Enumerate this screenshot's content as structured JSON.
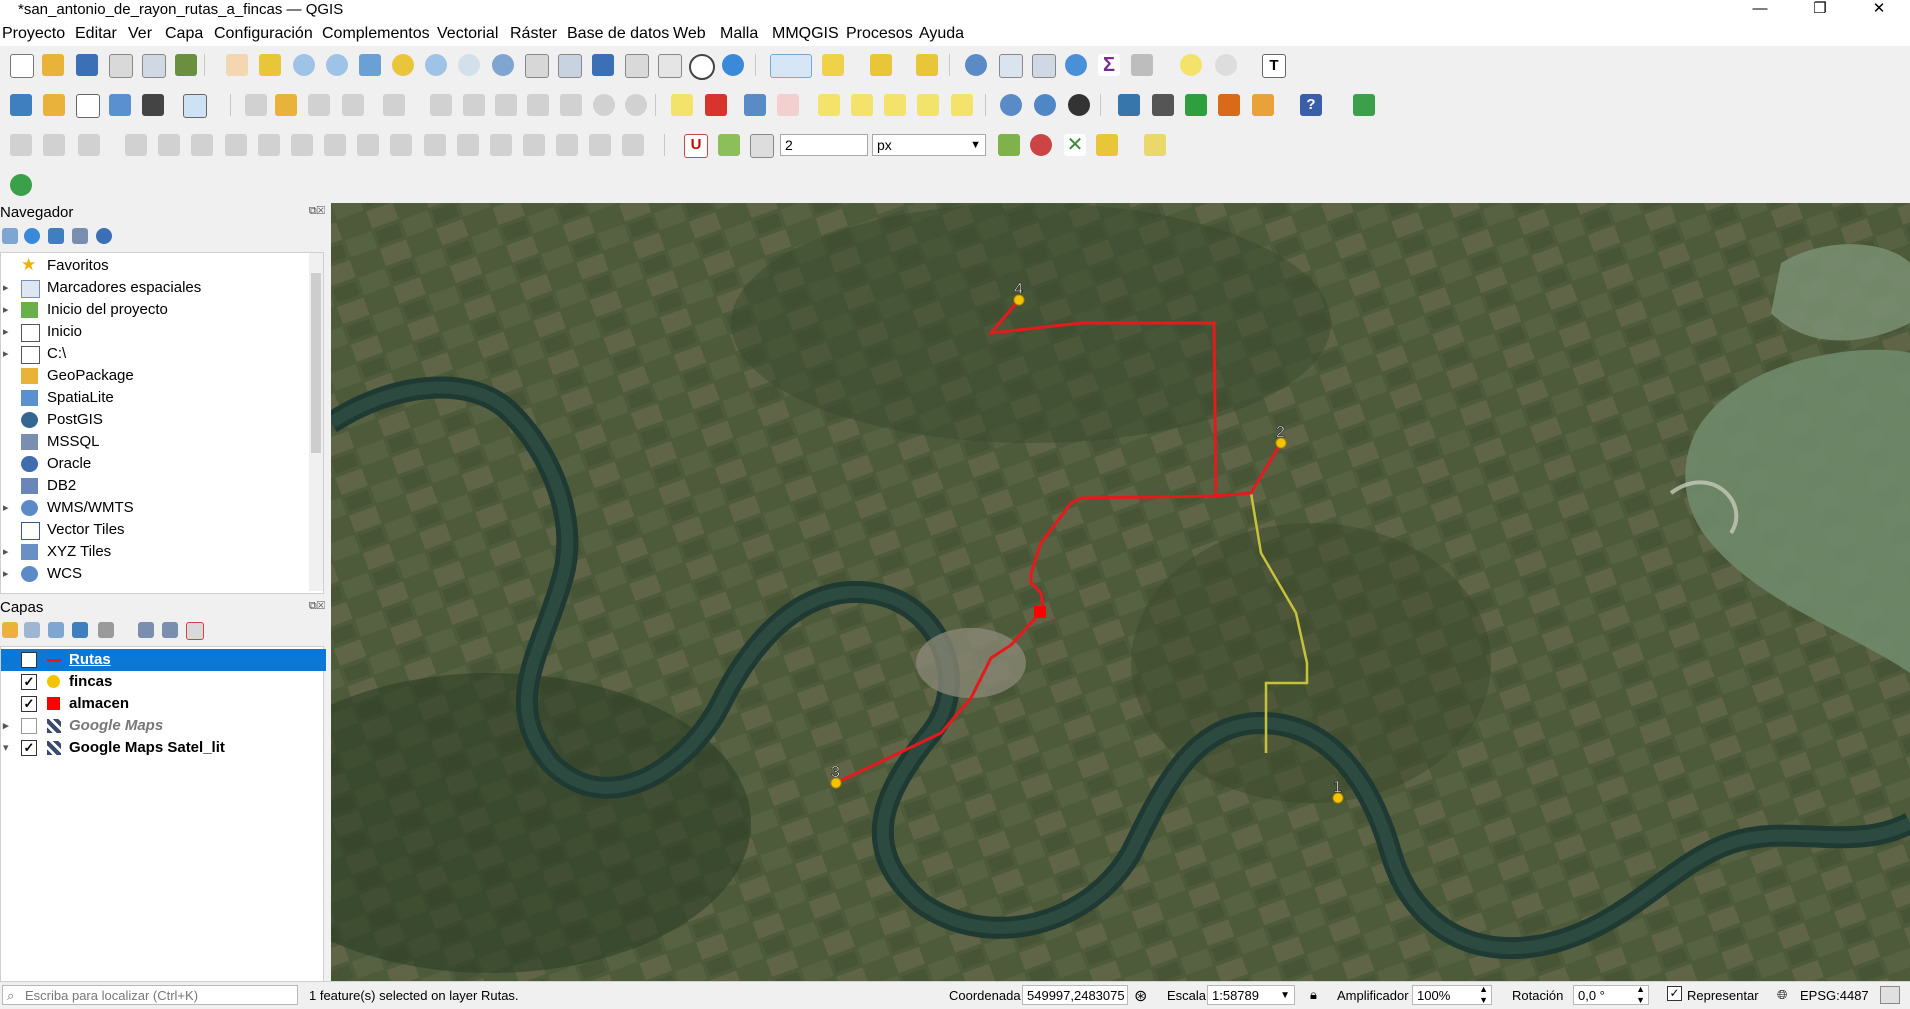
{
  "window": {
    "title": "*san_antonio_de_rayon_rutas_a_fincas — QGIS"
  },
  "menu": [
    "Proyecto",
    "Editar",
    "Ver",
    "Capa",
    "Configuración",
    "Complementos",
    "Vectorial",
    "Ráster",
    "Base de datos",
    "Web",
    "Malla",
    "MMQGIS",
    "Procesos",
    "Ayuda"
  ],
  "snapping": {
    "tolerance": "2",
    "unit": "px"
  },
  "browser": {
    "title": "Navegador",
    "items": [
      {
        "label": "Favoritos",
        "icon": "star-icon"
      },
      {
        "label": "Marcadores espaciales",
        "icon": "bookmark-icon"
      },
      {
        "label": "Inicio del proyecto",
        "icon": "project-home-icon"
      },
      {
        "label": "Inicio",
        "icon": "home-folder-icon"
      },
      {
        "label": "C:\\",
        "icon": "drive-icon"
      },
      {
        "label": "GeoPackage",
        "icon": "geopackage-icon"
      },
      {
        "label": "SpatiaLite",
        "icon": "spatialite-icon"
      },
      {
        "label": "PostGIS",
        "icon": "postgis-icon"
      },
      {
        "label": "MSSQL",
        "icon": "mssql-icon"
      },
      {
        "label": "Oracle",
        "icon": "oracle-icon"
      },
      {
        "label": "DB2",
        "icon": "db2-icon"
      },
      {
        "label": "WMS/WMTS",
        "icon": "wms-icon"
      },
      {
        "label": "Vector Tiles",
        "icon": "vector-tiles-icon"
      },
      {
        "label": "XYZ Tiles",
        "icon": "xyz-tiles-icon"
      },
      {
        "label": "WCS",
        "icon": "wcs-icon"
      }
    ]
  },
  "layers": {
    "title": "Capas",
    "items": [
      {
        "name": "Rutas",
        "checked": true,
        "selected": true,
        "symbol": "line",
        "color": "#e41a1c"
      },
      {
        "name": "fincas",
        "checked": true,
        "selected": false,
        "symbol": "point",
        "color": "#f5c400"
      },
      {
        "name": "almacen",
        "checked": true,
        "selected": false,
        "symbol": "square",
        "color": "#ff0000"
      },
      {
        "name": "Google Maps",
        "checked": false,
        "selected": false,
        "symbol": "tiles",
        "color": "#3a4a6a"
      },
      {
        "name": "Google Maps Satel_lit",
        "checked": true,
        "selected": false,
        "symbol": "tiles",
        "color": "#3a4a6a"
      }
    ]
  },
  "map": {
    "point_labels": [
      "4",
      "2",
      "3",
      "1"
    ]
  },
  "statusbar": {
    "locator_placeholder": "Escriba para localizar (Ctrl+K)",
    "message": "1 feature(s) selected on layer Rutas.",
    "coordinate_label": "Coordenada",
    "coordinate": "549997,2483075",
    "scale_label": "Escala",
    "scale": "1:58789",
    "magnifier_label": "Amplificador",
    "magnifier": "100%",
    "rotation_label": "Rotación",
    "rotation": "0,0 °",
    "render_label": "Representar",
    "crs": "EPSG:4487"
  }
}
